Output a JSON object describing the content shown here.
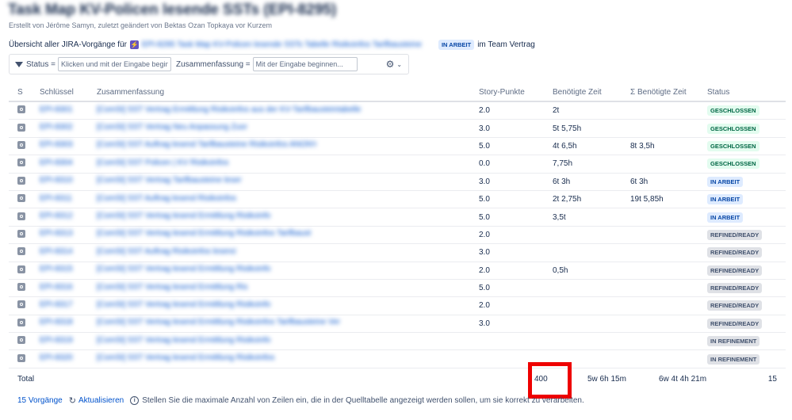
{
  "page": {
    "title": "Task Map KV-Policen lesende SSTs (EPI-8295)",
    "byline": "Erstellt von Jérôme Samyn, zuletzt geändert von Bektas Ozan Topkaya vor Kurzem"
  },
  "overview": {
    "prefix": "Übersicht aller JIRA-Vorgänge für",
    "epic_icon": "epic-icon",
    "epic_text": "EPI-8295 Task Map KV-Policen lesende SSTs Tabelle Risikoinfos Tarifbausteine",
    "epic_status": "IN ARBEIT",
    "suffix": "im Team Vertrag"
  },
  "filters": {
    "status_label": "Status =",
    "status_placeholder": "Klicken und mit der Eingabe beginnen...",
    "summary_label": "Zusammenfassung =",
    "summary_placeholder": "Mit der Eingabe beginnen...",
    "gear_icon": "⚙",
    "chevron_icon": "⌄"
  },
  "table": {
    "headers": [
      "S",
      "Schlüssel",
      "Zusammenfassung",
      "Story-Punkte",
      "Benötigte Zeit",
      "Σ Benötigte Zeit",
      "Status"
    ],
    "rows": [
      {
        "key": "EPI-8301",
        "summary": "[ComSt] SST Vertrag Ermittlung Risikoinfos aus der KV-Tarifbausteintabelle",
        "sp": "2.0",
        "time": "2t",
        "sum_time": "",
        "status": "GESCHLOSSEN",
        "status_type": "done"
      },
      {
        "key": "EPI-8302",
        "summary": "[ComSt] SST Vertrag Neu Anpassung Zuordnung Tarifbausteine Risikoinfos",
        "sp": "3.0",
        "time": "5t 5,75h",
        "sum_time": "",
        "status": "GESCHLOSSEN",
        "status_type": "done"
      },
      {
        "key": "EPI-8303",
        "summary": "[ComSt] SST Auftrag lesend Tarifbausteine Risikoinfos ANONYMISIERT",
        "sp": "5.0",
        "time": "4t 6,5h",
        "sum_time": "8t 3,5h",
        "status": "GESCHLOSSEN",
        "status_type": "done"
      },
      {
        "key": "EPI-8304",
        "summary": "[ComSt] SST Policen | KV Risikoinfos Ermittlung lesende SSTs",
        "sp": "0.0",
        "time": "7,75h",
        "sum_time": "",
        "status": "GESCHLOSSEN",
        "status_type": "done"
      },
      {
        "key": "EPI-8310",
        "summary": "[ComSt] SST Vertrag Tarifbausteine lesend Ermittlung",
        "sp": "3.0",
        "time": "6t 3h",
        "sum_time": "6t 3h",
        "status": "IN ARBEIT",
        "status_type": "progress"
      },
      {
        "key": "EPI-8311",
        "summary": "[ComSt] SST Auftrag lesend Risikoinfos",
        "sp": "5.0",
        "time": "2t 2,75h",
        "sum_time": "19t 5,85h",
        "status": "IN ARBEIT",
        "status_type": "progress"
      },
      {
        "key": "EPI-8312",
        "summary": "[ComSt] SST Vertrag lesend Ermittlung Risikoinfos Tarifbausteine lesend",
        "sp": "5.0",
        "time": "3,5t",
        "sum_time": "",
        "status": "IN ARBEIT",
        "status_type": "progress"
      },
      {
        "key": "EPI-8313",
        "summary": "[ComSt] SST Vertrag lesend Ermittlung Risikoinfos Tarifbausteine Vertragsdaten Ermittlung lesend",
        "sp": "2.0",
        "time": "",
        "sum_time": "",
        "status": "REFINED/READY",
        "status_type": "grey"
      },
      {
        "key": "EPI-8314",
        "summary": "[ComSt] SST Auftrag Risikoinfos lesend und Ermittlung",
        "sp": "3.0",
        "time": "",
        "sum_time": "",
        "status": "REFINED/READY",
        "status_type": "grey"
      },
      {
        "key": "EPI-8315",
        "summary": "[ComSt] SST Vertrag lesend Ermittlung Risikoinfos Tarifbausteine",
        "sp": "2.0",
        "time": "0,5h",
        "sum_time": "",
        "status": "REFINED/READY",
        "status_type": "grey"
      },
      {
        "key": "EPI-8316",
        "summary": "[ComSt] SST Vertrag lesend Ermittlung Risikoinfos",
        "sp": "5.0",
        "time": "",
        "sum_time": "",
        "status": "REFINED/READY",
        "status_type": "grey"
      },
      {
        "key": "EPI-8317",
        "summary": "[ComSt] SST Vertrag lesend Ermittlung Risikoinfos Tarifbausteine lesend",
        "sp": "2.0",
        "time": "",
        "sum_time": "",
        "status": "REFINED/READY",
        "status_type": "grey"
      },
      {
        "key": "EPI-8318",
        "summary": "[ComSt] SST Vertrag lesend Ermittlung Risikoinfos Tarifbausteine Vertragsdaten Ermittlung lesend Ermittlung",
        "sp": "3.0",
        "time": "",
        "sum_time": "",
        "status": "REFINED/READY",
        "status_type": "grey"
      },
      {
        "key": "EPI-8319",
        "summary": "[ComSt] SST Vertrag lesend Ermittlung Risikoinfos lesend",
        "sp": "",
        "time": "",
        "sum_time": "",
        "status": "IN REFINEMENT",
        "status_type": "grey"
      },
      {
        "key": "EPI-8320",
        "summary": "[ComSt] SST Vertrag lesend Ermittlung Risikoinfos Tarifbausteine lesend",
        "sp": "",
        "time": "",
        "sum_time": "",
        "status": "IN REFINEMENT",
        "status_type": "grey"
      }
    ],
    "total": {
      "label": "Total",
      "sp": "400",
      "time": "5w 6h 15m",
      "sum_time": "6w 4t 4h 21m",
      "count": "15"
    }
  },
  "footer": {
    "count_label": "15 Vorgänge",
    "refresh_icon": "↻",
    "refresh_label": "Aktualisieren",
    "info_icon": "i",
    "message": "Stellen Sie die maximale Anzahl von Zeilen ein, die in der Quelltabelle angezeigt werden sollen, um sie korrekt zu verarbeiten."
  }
}
